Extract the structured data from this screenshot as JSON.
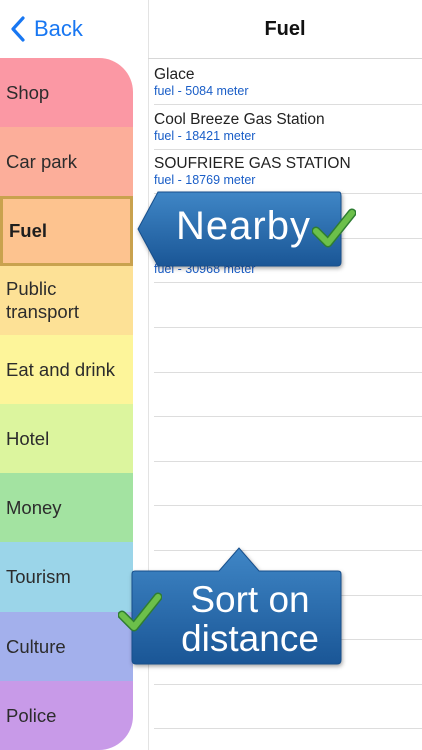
{
  "nav": {
    "back_label": "Back"
  },
  "header": {
    "title": "Fuel"
  },
  "categories": [
    {
      "label": "Shop",
      "color": "#fb98a4"
    },
    {
      "label": "Car park",
      "color": "#fcae9a"
    },
    {
      "label": "Fuel",
      "color": "#fdc38f",
      "selected": true
    },
    {
      "label": "Public transport",
      "color": "#fde196"
    },
    {
      "label": "Eat and drink",
      "color": "#fdf59a"
    },
    {
      "label": "Hotel",
      "color": "#dcf59e"
    },
    {
      "label": "Money",
      "color": "#a3e3a1"
    },
    {
      "label": "Tourism",
      "color": "#9bd5e9"
    },
    {
      "label": "Culture",
      "color": "#a3b0ec"
    },
    {
      "label": "Police",
      "color": "#c89ae8"
    }
  ],
  "stations": [
    {
      "name": "Glace",
      "detail": "fuel - 5084 meter"
    },
    {
      "name": "Cool Breeze Gas Station",
      "detail": "fuel - 18421 meter"
    },
    {
      "name": "SOUFRIERE GAS STATION",
      "detail": "fuel - 18769 meter"
    },
    {
      "name": "",
      "detail": ""
    },
    {
      "name": "",
      "detail": "fuel - 30968 meter"
    }
  ],
  "callouts": {
    "nearby": "Nearby",
    "sort_line1": "Sort on",
    "sort_line2": "distance"
  },
  "colors": {
    "accent": "#1877f2",
    "callout_blue": "#1f5fa3",
    "check_green": "#4caf50"
  }
}
